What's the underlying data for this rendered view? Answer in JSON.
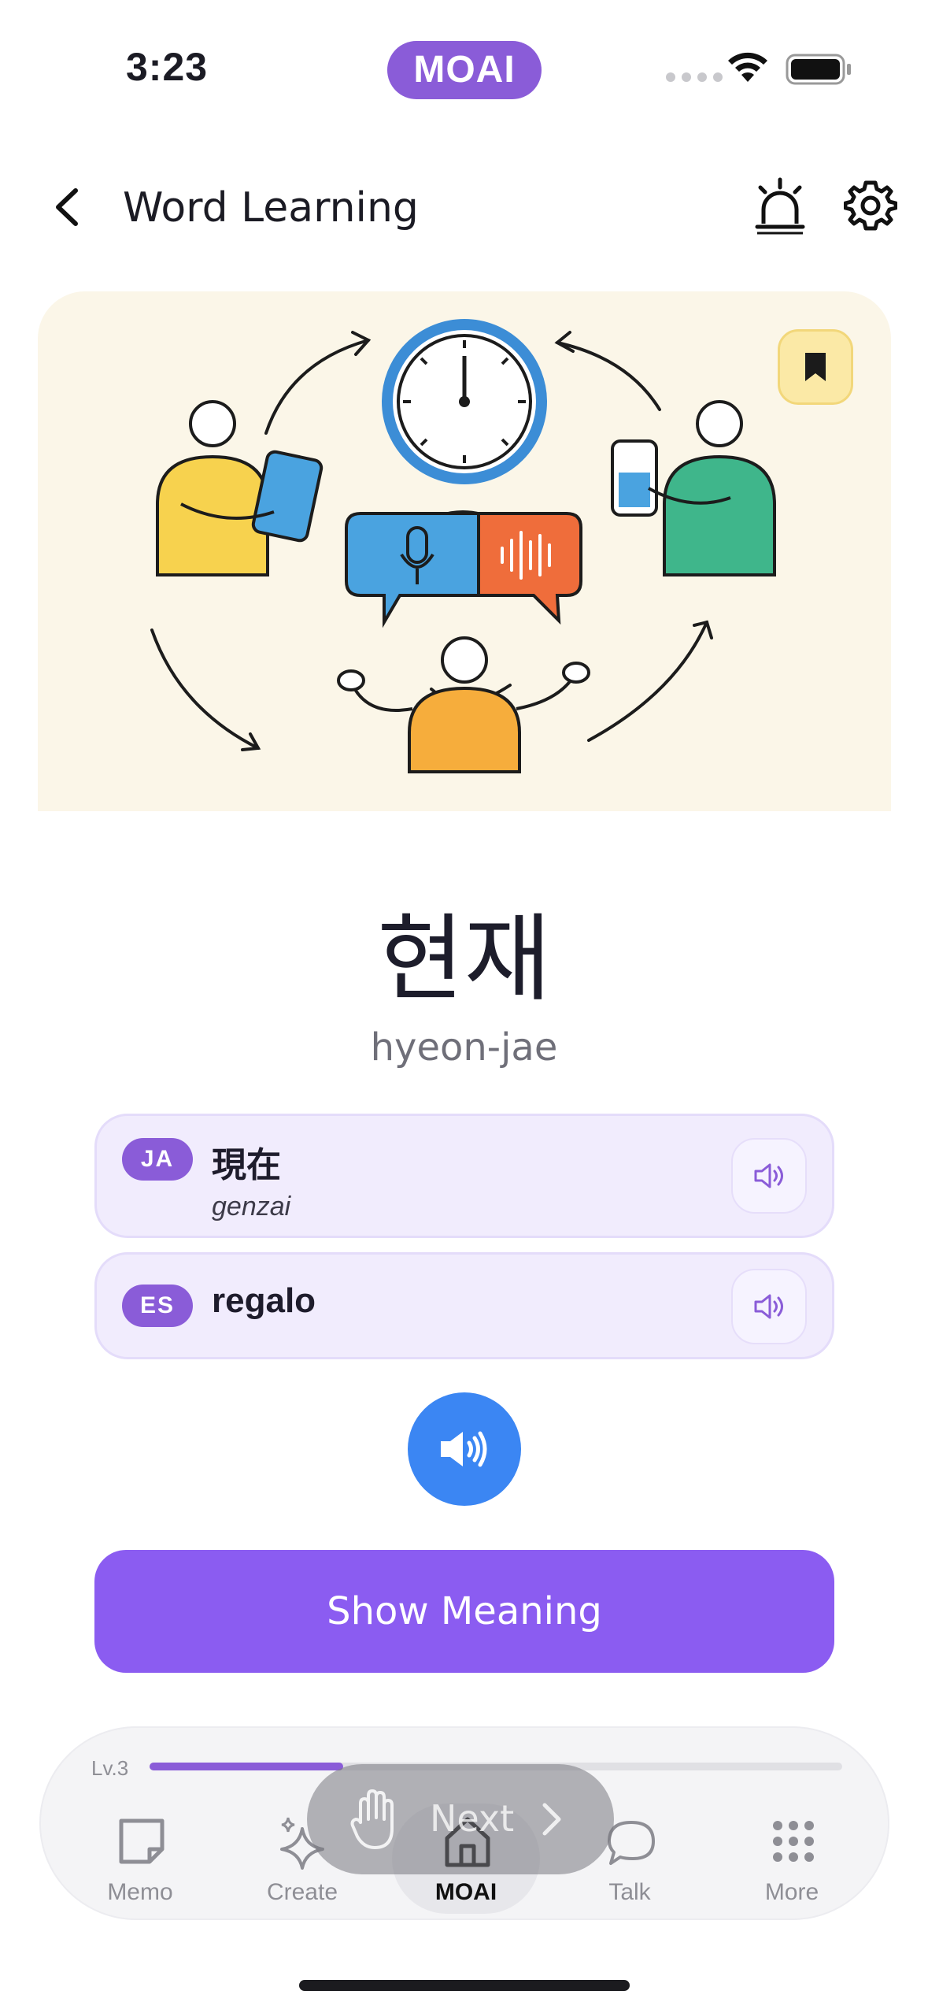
{
  "status_bar": {
    "time": "3:23",
    "brand": "MOAI"
  },
  "header": {
    "title": "Word Learning"
  },
  "word": {
    "hangul": "현재",
    "romanization": "hyeon-jae"
  },
  "translations": [
    {
      "lang_code": "JA",
      "text": "現在",
      "reading": "genzai"
    },
    {
      "lang_code": "ES",
      "text": "regalo"
    }
  ],
  "actions": {
    "show_meaning_label": "Show Meaning",
    "next_label": "Next"
  },
  "progress": {
    "level_label": "Lv.3",
    "level_progress": 0.28
  },
  "nav": {
    "items": [
      {
        "label": "Memo",
        "icon": "memo-icon"
      },
      {
        "label": "Create",
        "icon": "sparkle-icon"
      },
      {
        "label": "MOAI",
        "icon": "home-icon",
        "active": true
      },
      {
        "label": "Talk",
        "icon": "chat-bubble-icon"
      },
      {
        "label": "More",
        "icon": "grid-dots-icon"
      }
    ]
  },
  "colors": {
    "brand_purple": "#8a5cd8",
    "button_purple": "#8b5cf1",
    "speaker_blue": "#3b86f3",
    "card_bg": "#fbf6e8"
  }
}
